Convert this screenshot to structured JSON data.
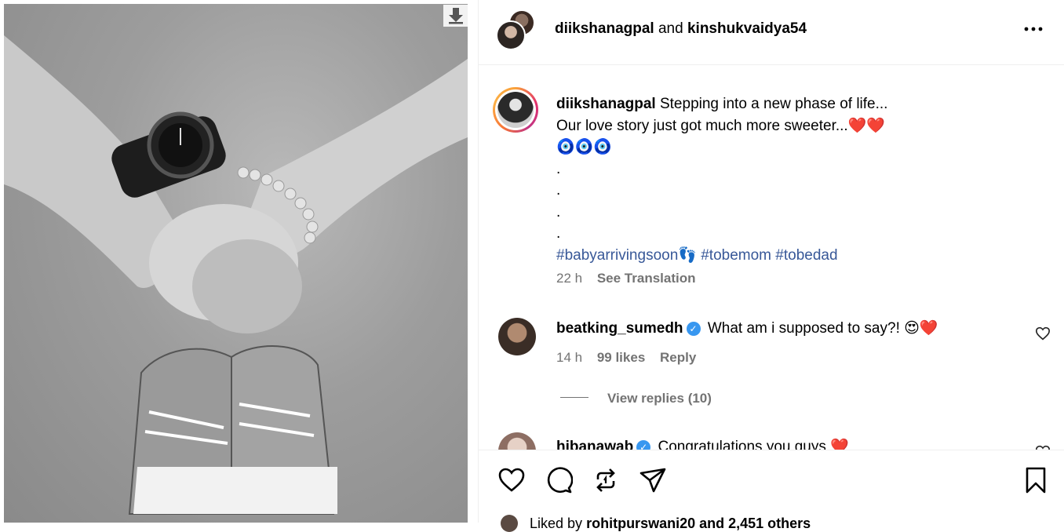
{
  "header": {
    "user1": "diikshanagpal",
    "joiner": "and",
    "user2": "kinshukvaidya54",
    "more_label": "•••"
  },
  "caption": {
    "username": "diikshanagpal",
    "line1": "Stepping into a new phase of life...",
    "line2": "Our love story just got much more sweeter...",
    "line2_emoji": "❤️❤️",
    "evil_eyes": "🧿🧿🧿",
    "dots": [
      ".",
      ".",
      ".",
      "."
    ],
    "hashtag1": "#babyarrivingsoon",
    "feet_emoji": "👣",
    "hashtag2": "#tobemom",
    "hashtag3": "#tobedad",
    "time": "22 h",
    "see_translation": "See Translation"
  },
  "comments": [
    {
      "username": "beatking_sumedh",
      "text": "What am i supposed to say?!",
      "emoji": "😍❤️",
      "time": "14 h",
      "likes": "99 likes",
      "reply": "Reply",
      "view_replies": "View replies (10)"
    },
    {
      "username": "hibanawab",
      "text": "Congratulations you guys",
      "emoji": "❤️"
    }
  ],
  "liked_by": {
    "prefix": "Liked by",
    "user": "rohitpurswani20",
    "suffix": "and 2,451 others"
  },
  "icons": {
    "download": "download-arrow-icon",
    "like": "heart-icon",
    "comment": "comment-icon",
    "share": "repost-icon",
    "send": "send-icon",
    "save": "bookmark-icon"
  }
}
